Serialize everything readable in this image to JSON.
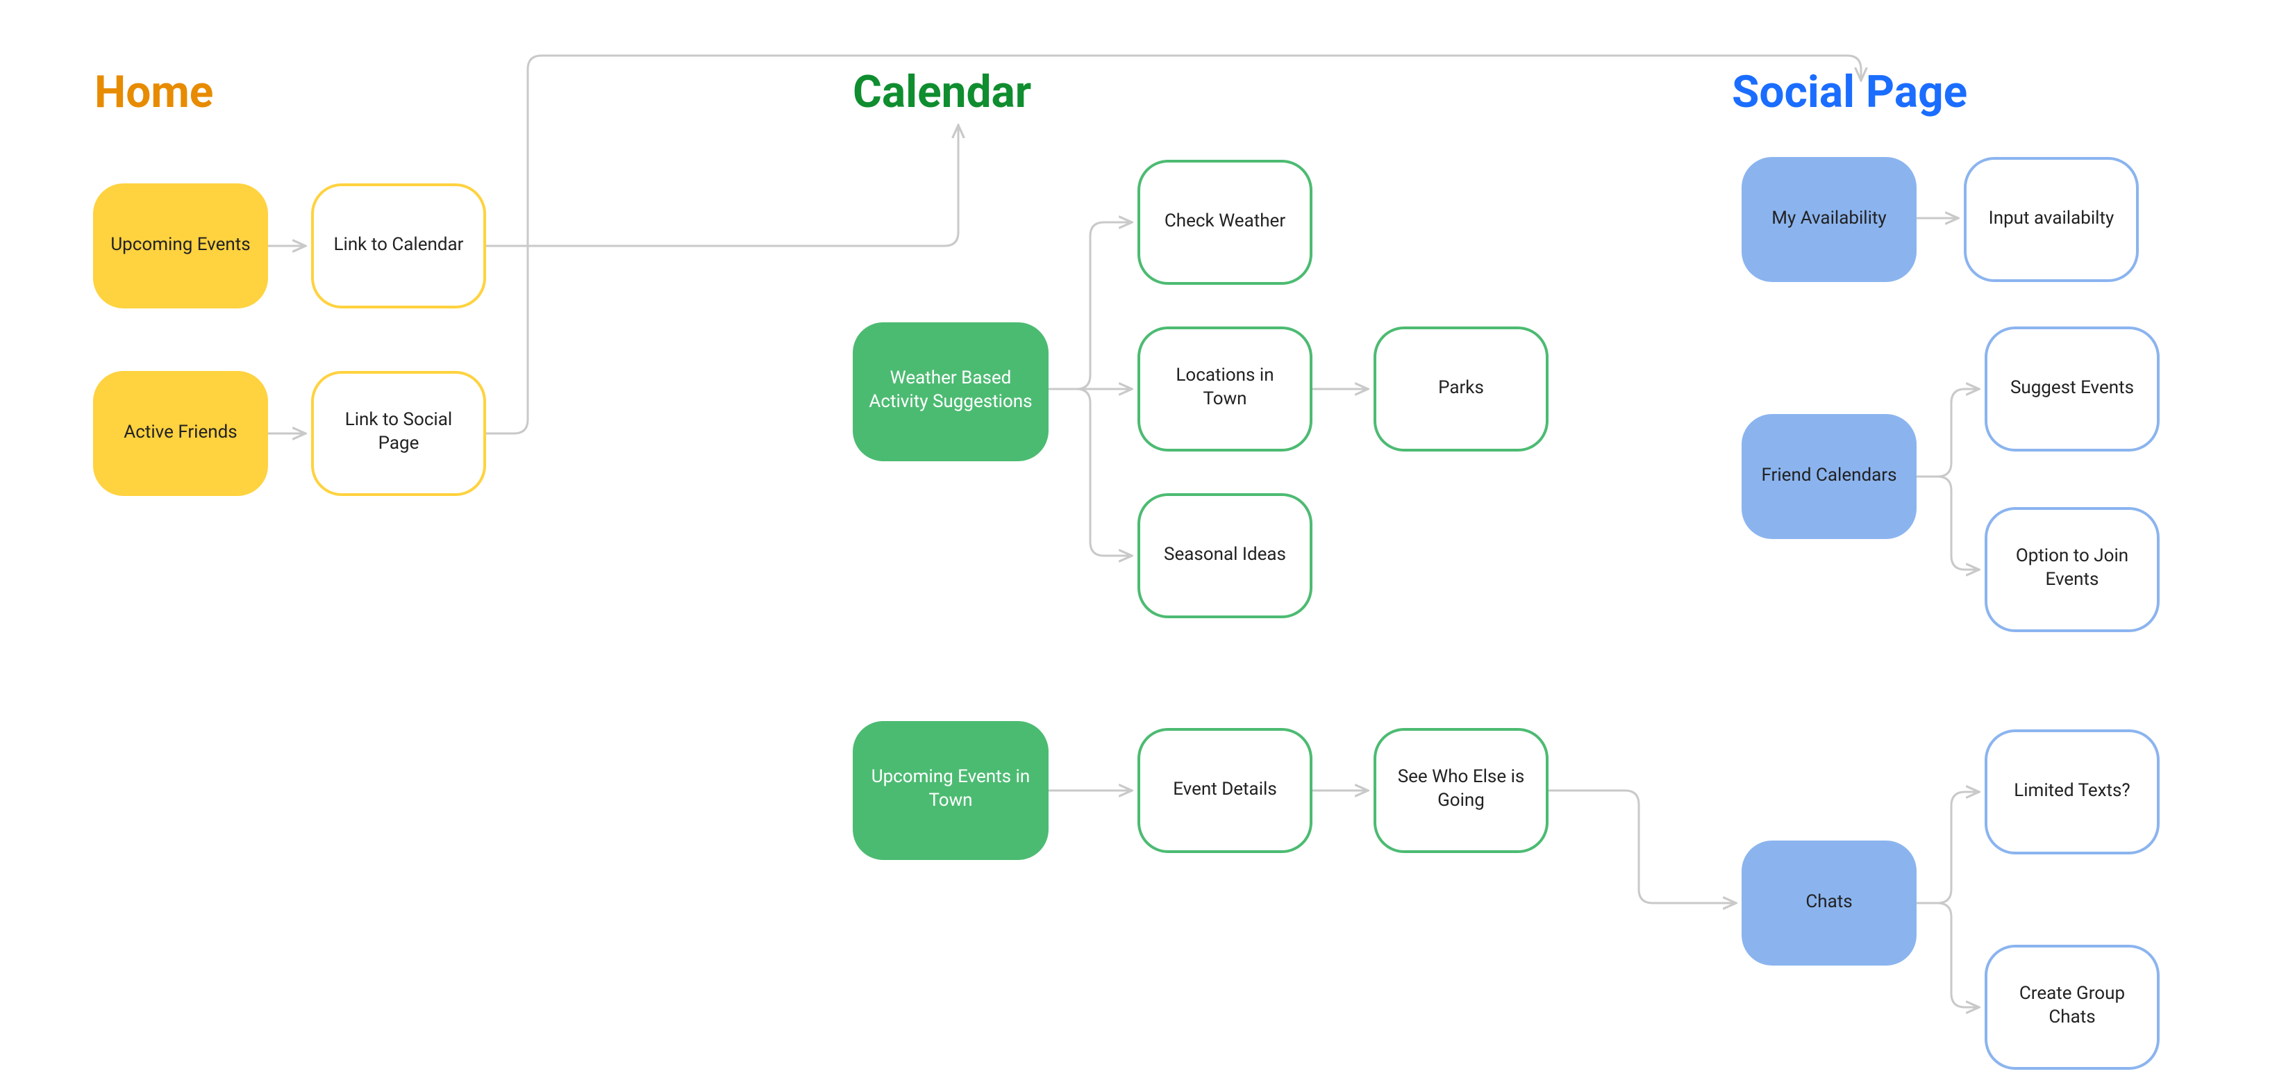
{
  "headings": {
    "home": {
      "text": "Home",
      "color": "#e78b00"
    },
    "calendar": {
      "text": "Calendar",
      "color": "#0f8d2f"
    },
    "social": {
      "text": "Social Page",
      "color": "#1a6dff"
    }
  },
  "nodes": {
    "upcoming_events": "Upcoming Events",
    "active_friends": "Active Friends",
    "link_to_calendar": "Link to Calendar",
    "link_to_social_page": "Link to Social Page",
    "weather_suggestions": "Weather Based Activity Suggestions",
    "check_weather": "Check Weather",
    "locations_in_town": "Locations in Town",
    "seasonal_ideas": "Seasonal Ideas",
    "parks": "Parks",
    "upcoming_events_town": "Upcoming Events in Town",
    "event_details": "Event Details",
    "see_who_else_going": "See Who Else is Going",
    "my_availability": "My Availability",
    "input_availability": "Input availabilty",
    "friend_calendars": "Friend Calendars",
    "suggest_events": "Suggest Events",
    "option_join_events": "Option to Join Events",
    "chats": "Chats",
    "limited_texts": "Limited Texts?",
    "create_group_chats": "Create Group Chats"
  }
}
